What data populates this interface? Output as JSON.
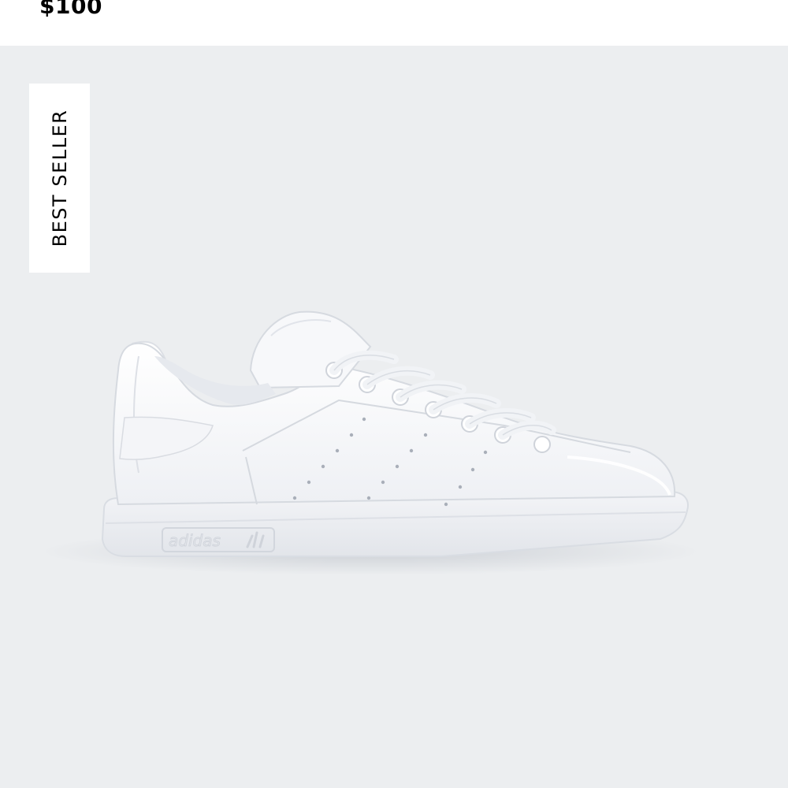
{
  "product": {
    "price": "$100",
    "badge": "BEST SELLER",
    "brand_embossing": "adidas",
    "image_icon": "sneaker-image"
  },
  "colors": {
    "image_background": "#eceef0",
    "badge_background": "#ffffff",
    "text": "#000000"
  }
}
